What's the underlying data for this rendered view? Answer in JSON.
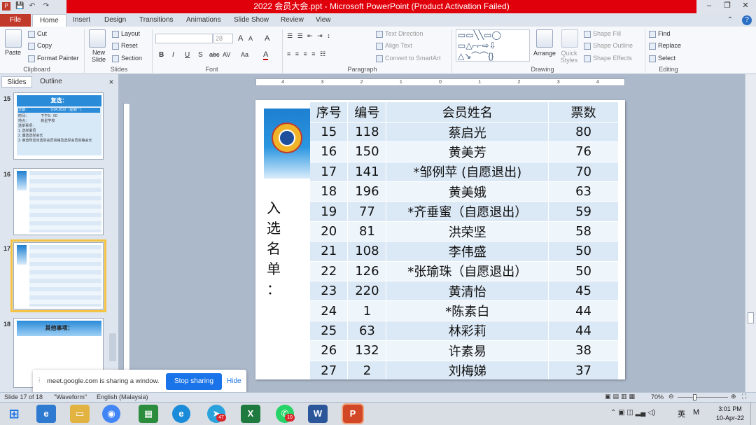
{
  "window": {
    "title": "2022 会员大会.ppt - Microsoft PowerPoint (Product Activation Failed)",
    "minimize": "–",
    "restore": "❐",
    "close": "✕"
  },
  "qat": {
    "save": "💾",
    "undo": "↶",
    "redo": "↷"
  },
  "tabs": [
    {
      "label": "File"
    },
    {
      "label": "Home"
    },
    {
      "label": "Insert"
    },
    {
      "label": "Design"
    },
    {
      "label": "Transitions"
    },
    {
      "label": "Animations"
    },
    {
      "label": "Slide Show"
    },
    {
      "label": "Review"
    },
    {
      "label": "View"
    }
  ],
  "ribbon": {
    "clipboard": {
      "paste": "Paste",
      "cut": "Cut",
      "copy": "Copy",
      "format_painter": "Format Painter",
      "label": "Clipboard"
    },
    "slides": {
      "new_slide": "New Slide",
      "layout": "Layout",
      "reset": "Reset",
      "section": "Section",
      "label": "Slides"
    },
    "font": {
      "font_name": "",
      "font_size": "28",
      "label": "Font",
      "bold": "B",
      "italic": "I",
      "underline": "U",
      "shadow": "S",
      "strike": "abc",
      "spacing": "AV",
      "case": "Aa",
      "grow": "A",
      "shrink": "A"
    },
    "paragraph": {
      "text_direction": "Text Direction",
      "align_text": "Align Text",
      "smartart": "Convert to SmartArt",
      "label": "Paragraph"
    },
    "drawing": {
      "arrange": "Arrange",
      "quick_styles": "Quick Styles",
      "shape_fill": "Shape Fill",
      "shape_outline": "Shape Outline",
      "shape_effects": "Shape Effects",
      "label": "Drawing"
    },
    "editing": {
      "find": "Find",
      "replace": "Replace",
      "select": "Select",
      "label": "Editing"
    }
  },
  "pane": {
    "tab_slides": "Slides",
    "tab_outline": "Outline",
    "close": "×"
  },
  "thumbnails": [
    {
      "num": "15",
      "title": "复选：",
      "line1": "日期：",
      "line1b": "9.04.2022（星期一）",
      "line2": "时间：",
      "line2b": "下午5：00",
      "line3": "地点：",
      "line3b": "新星学校",
      "line4": "选举事项：",
      "line5": "1. 选举委员",
      "line6": "2. 遴选选举会长",
      "line7": "3. 审查所发出选举会员资格及选举会员资格会长"
    },
    {
      "num": "16"
    },
    {
      "num": "17"
    },
    {
      "num": "18",
      "title": "其他事项："
    }
  ],
  "slide": {
    "side_title": [
      "入",
      "选",
      "名",
      "单",
      "："
    ],
    "columns": [
      "序号",
      "编号",
      "会员姓名",
      "票数"
    ],
    "rows": [
      [
        "15",
        "118",
        "蔡启光",
        "80"
      ],
      [
        "16",
        "150",
        "黄美芳",
        "76"
      ],
      [
        "17",
        "141",
        "*邹例苹 (自愿退出)",
        "70"
      ],
      [
        "18",
        "196",
        "黄美娥",
        "63"
      ],
      [
        "19",
        "77",
        "*齐垂蜜（自愿退出）",
        "59"
      ],
      [
        "20",
        "81",
        "洪荣坚",
        "58"
      ],
      [
        "21",
        "108",
        "李伟盛",
        "50"
      ],
      [
        "22",
        "126",
        "*张瑜珠（自愿退出）",
        "50"
      ],
      [
        "23",
        "220",
        "黄清怡",
        "45"
      ],
      [
        "24",
        "1",
        "*陈素白",
        "44"
      ],
      [
        "25",
        "63",
        "林彩莉",
        "44"
      ],
      [
        "26",
        "132",
        "许素易",
        "38"
      ],
      [
        "27",
        "2",
        "刘梅娣",
        "37"
      ]
    ]
  },
  "share": {
    "text": "meet.google.com is sharing a window.",
    "stop": "Stop sharing",
    "hide": "Hide"
  },
  "status": {
    "slide_of": "Slide 17 of 18",
    "theme": "\"Waveform\"",
    "language": "English (Malaysia)",
    "zoom": "70%"
  },
  "ruler": {
    "marks": [
      "4",
      "3",
      "2",
      "1",
      "0",
      "1",
      "2",
      "3",
      "4"
    ]
  },
  "taskbar": {
    "time": "3:01 PM",
    "date": "10-Apr-22",
    "ime": "英",
    "ime2": "M",
    "telegram_badge": "47",
    "whatsapp_badge": "10"
  }
}
